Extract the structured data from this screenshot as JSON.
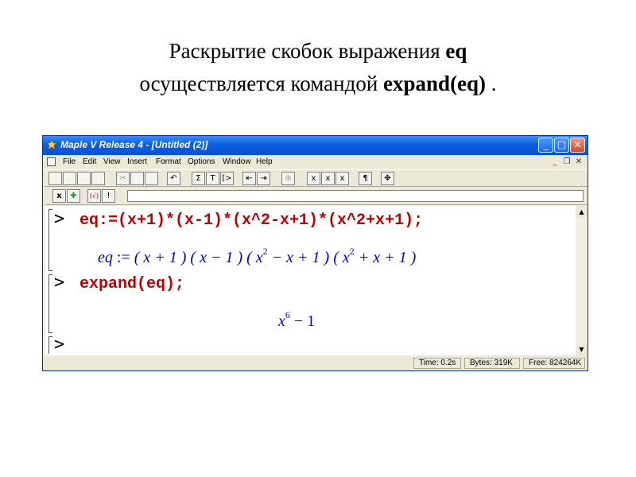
{
  "slide": {
    "line1_text": "Раскрытие скобок выражения ",
    "line1_bold": "eq",
    "line2_text": "осуществляется командой ",
    "line2_bold": "expand(eq)",
    "line2_end": " ."
  },
  "window": {
    "title": "Maple V Release 4 - [Untitled (2)]",
    "minimize": "_",
    "maximize": "□",
    "close": "✕"
  },
  "menu": {
    "items": [
      "File",
      "Edit",
      "View",
      "Insert",
      "Format",
      "Options",
      "Window",
      "Help"
    ],
    "mdi_min": "_",
    "mdi_restore": "❐",
    "mdi_close": "✕"
  },
  "toolbar": {
    "icons": [
      "new-icon",
      "open-icon",
      "save-icon",
      "print-icon",
      "cut-icon",
      "copy-icon",
      "paste-icon",
      "undo-icon",
      "sigma-icon",
      "text-icon",
      "prompt-icon",
      "outdent-icon",
      "indent-icon",
      "stop-icon",
      "x-icon",
      "x-icon",
      "x-bold-icon",
      "pilcrow-icon",
      "move-icon"
    ],
    "labels": [
      "",
      "",
      "",
      "",
      "✂",
      "",
      "",
      "↶",
      "Σ",
      "T",
      "[>",
      "⇤",
      "⇥",
      "⊛",
      "x",
      "x",
      "x",
      "¶",
      "✥"
    ]
  },
  "toolbar2": {
    "labels": [
      "x",
      "✚",
      "(√)",
      "!"
    ]
  },
  "worksheet": {
    "prompt1": ">",
    "input1": "eq:=(x+1)*(x-1)*(x^2-x+1)*(x^2+x+1);",
    "output1_lhs": "eq",
    "output1_assign": " := ",
    "output1_rhs_a": "( x + 1 ) ( x − 1 ) ( x",
    "output1_exp1": "2",
    "output1_rhs_b": " − x + 1 ) ( x",
    "output1_exp2": "2",
    "output1_rhs_c": " + x + 1 )",
    "prompt2": ">",
    "input2": "expand(eq);",
    "output2_base": "x",
    "output2_exp": "6",
    "output2_rest": " − 1",
    "prompt3": ">"
  },
  "status": {
    "time": "Time:   0.2s",
    "bytes": "Bytes:   319K",
    "free": "Free:   824264K"
  },
  "colors": {
    "input": "#c00000",
    "output": "#0000cc",
    "titlebar": "#0a5fe0"
  }
}
